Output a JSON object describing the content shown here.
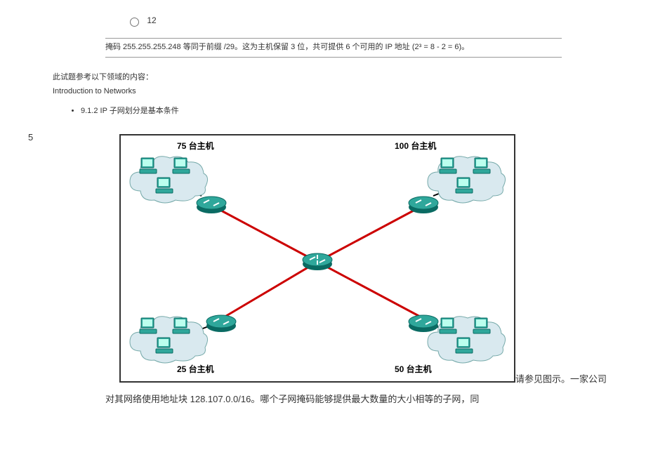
{
  "radio": {
    "value": "12"
  },
  "explanation": "掩码 255.255.255.248 等同于前缀 /29。这为主机保留 3 位，共可提供 6 个可用的 IP 地址 (2³ = 8 - 2 = 6)。",
  "reference": {
    "intro": "此试题参考以下领域的内容：",
    "course": "Introduction to Networks",
    "bullet": "9.1.2 IP 子网划分是基本条件"
  },
  "question": {
    "number": "5",
    "labels": {
      "tl": "75 台主机",
      "tr": "100 台主机",
      "bl": "25 台主机",
      "br": "50 台主机"
    },
    "trailing": "请参见图示。一家公司",
    "line2": "对其网络使用地址块 128.107.0.0/16。哪个子网掩码能够提供最大数量的大小相等的子网，同"
  }
}
